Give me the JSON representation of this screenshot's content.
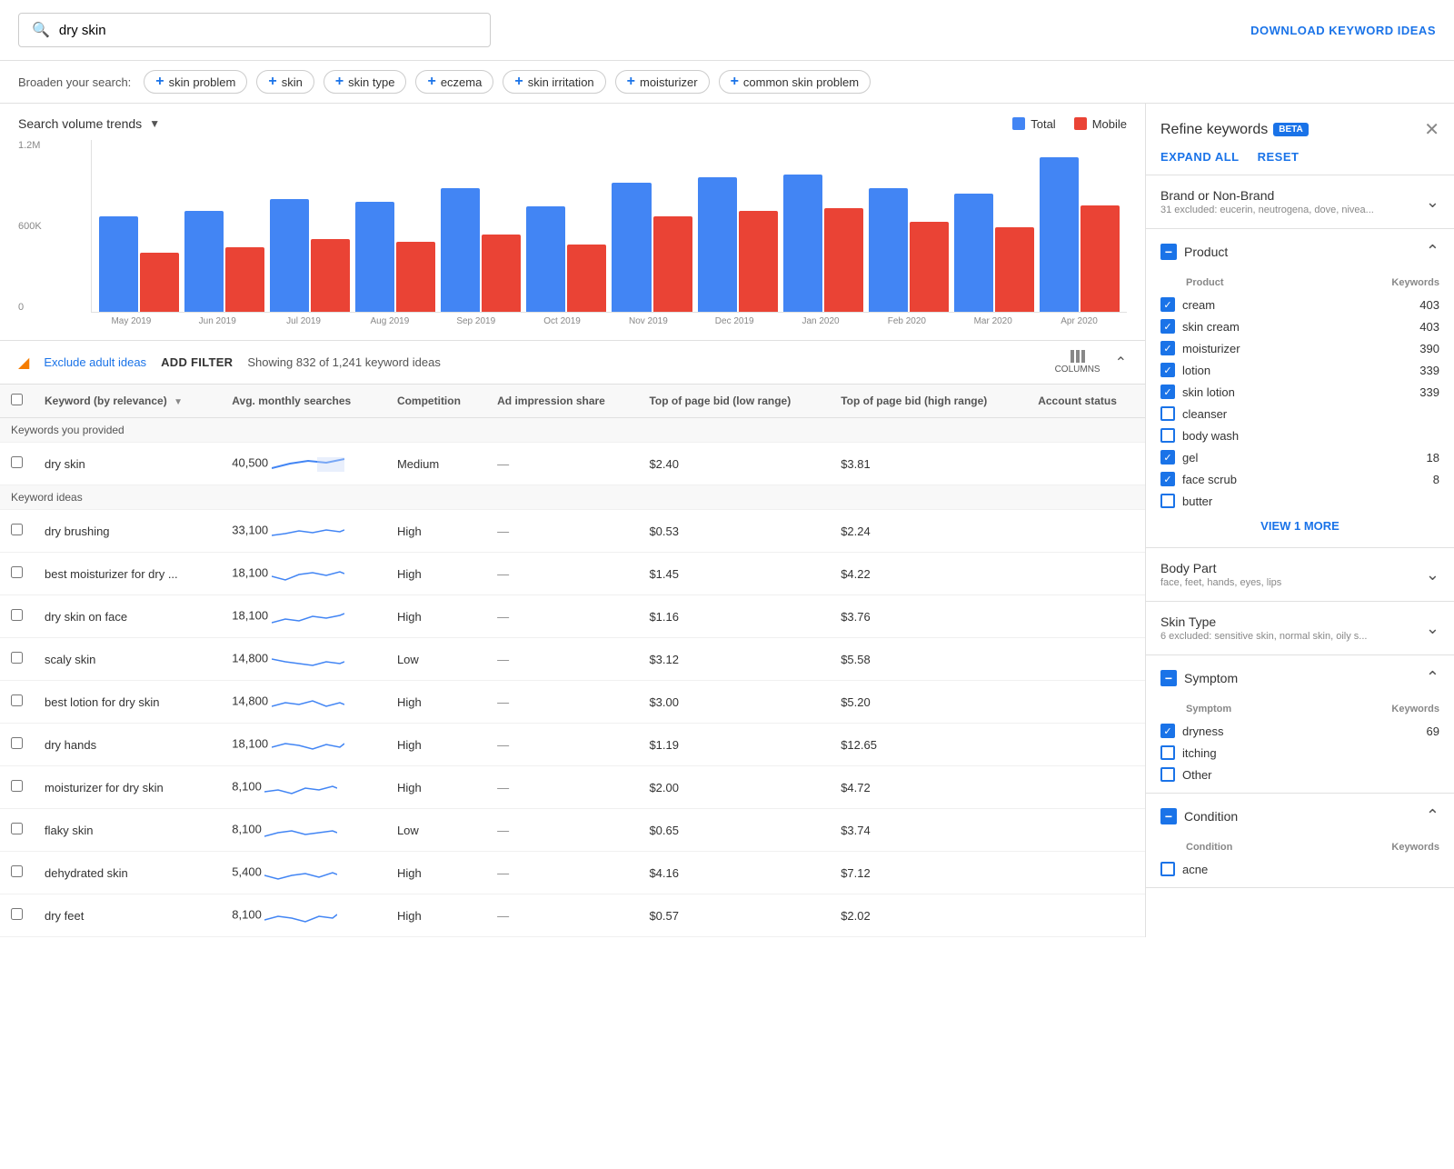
{
  "topbar": {
    "search_placeholder": "dry skin",
    "search_value": "dry skin",
    "download_label": "DOWNLOAD KEYWORD IDEAS"
  },
  "broaden": {
    "label": "Broaden your search:",
    "chips": [
      {
        "id": "skin-problem",
        "label": "skin problem"
      },
      {
        "id": "skin",
        "label": "skin"
      },
      {
        "id": "skin-type",
        "label": "skin type"
      },
      {
        "id": "eczema",
        "label": "eczema"
      },
      {
        "id": "skin-irritation",
        "label": "skin irritation"
      },
      {
        "id": "moisturizer",
        "label": "moisturizer"
      },
      {
        "id": "common-skin-problem",
        "label": "common skin problem"
      }
    ]
  },
  "chart": {
    "title": "Search volume trends",
    "y_labels": [
      "1.2M",
      "600K",
      "0"
    ],
    "legend": {
      "total_label": "Total",
      "mobile_label": "Mobile"
    },
    "x_labels": [
      "May 2019",
      "Jun 2019",
      "Jul 2019",
      "Aug 2019",
      "Sep 2019",
      "Oct 2019",
      "Nov 2019",
      "Dec 2019",
      "Jan 2020",
      "Feb 2020",
      "Mar 2020",
      "Apr 2020"
    ],
    "bars": [
      {
        "month": "May 2019",
        "total": 68,
        "mobile": 42
      },
      {
        "month": "Jun 2019",
        "total": 72,
        "mobile": 46
      },
      {
        "month": "Jul 2019",
        "total": 80,
        "mobile": 52
      },
      {
        "month": "Aug 2019",
        "total": 78,
        "mobile": 50
      },
      {
        "month": "Sep 2019",
        "total": 88,
        "mobile": 55
      },
      {
        "month": "Oct 2019",
        "total": 75,
        "mobile": 48
      },
      {
        "month": "Nov 2019",
        "total": 92,
        "mobile": 68
      },
      {
        "month": "Dec 2019",
        "total": 96,
        "mobile": 72
      },
      {
        "month": "Jan 2020",
        "total": 98,
        "mobile": 74
      },
      {
        "month": "Feb 2020",
        "total": 88,
        "mobile": 64
      },
      {
        "month": "Mar 2020",
        "total": 84,
        "mobile": 60
      },
      {
        "month": "Apr 2020",
        "total": 110,
        "mobile": 76
      }
    ]
  },
  "toolbar": {
    "exclude_label": "Exclude adult ideas",
    "add_filter_label": "ADD FILTER",
    "showing_text": "Showing 832 of 1,241 keyword ideas",
    "columns_label": "COLUMNS"
  },
  "table": {
    "headers": {
      "keyword": "Keyword (by relevance)",
      "avg_monthly": "Avg. monthly searches",
      "competition": "Competition",
      "ad_impression": "Ad impression share",
      "top_page_low": "Top of page bid (low range)",
      "top_page_high": "Top of page bid (high range)",
      "account_status": "Account status"
    },
    "provided_label": "Keywords you provided",
    "ideas_label": "Keyword ideas",
    "provided_rows": [
      {
        "keyword": "dry skin",
        "avg": "40,500",
        "competition": "Medium",
        "ad_impression": "—",
        "bid_low": "$2.40",
        "bid_high": "$3.81"
      }
    ],
    "idea_rows": [
      {
        "keyword": "dry brushing",
        "avg": "33,100",
        "competition": "High",
        "ad_impression": "—",
        "bid_low": "$0.53",
        "bid_high": "$2.24"
      },
      {
        "keyword": "best moisturizer for dry ...",
        "avg": "18,100",
        "competition": "High",
        "ad_impression": "—",
        "bid_low": "$1.45",
        "bid_high": "$4.22"
      },
      {
        "keyword": "dry skin on face",
        "avg": "18,100",
        "competition": "High",
        "ad_impression": "—",
        "bid_low": "$1.16",
        "bid_high": "$3.76"
      },
      {
        "keyword": "scaly skin",
        "avg": "14,800",
        "competition": "Low",
        "ad_impression": "—",
        "bid_low": "$3.12",
        "bid_high": "$5.58"
      },
      {
        "keyword": "best lotion for dry skin",
        "avg": "14,800",
        "competition": "High",
        "ad_impression": "—",
        "bid_low": "$3.00",
        "bid_high": "$5.20"
      },
      {
        "keyword": "dry hands",
        "avg": "18,100",
        "competition": "High",
        "ad_impression": "—",
        "bid_low": "$1.19",
        "bid_high": "$12.65"
      },
      {
        "keyword": "moisturizer for dry skin",
        "avg": "8,100",
        "competition": "High",
        "ad_impression": "—",
        "bid_low": "$2.00",
        "bid_high": "$4.72"
      },
      {
        "keyword": "flaky skin",
        "avg": "8,100",
        "competition": "Low",
        "ad_impression": "—",
        "bid_low": "$0.65",
        "bid_high": "$3.74"
      },
      {
        "keyword": "dehydrated skin",
        "avg": "5,400",
        "competition": "High",
        "ad_impression": "—",
        "bid_low": "$4.16",
        "bid_high": "$7.12"
      },
      {
        "keyword": "dry feet",
        "avg": "8,100",
        "competition": "High",
        "ad_impression": "—",
        "bid_low": "$0.57",
        "bid_high": "$2.02"
      }
    ]
  },
  "refine": {
    "title": "Refine keywords",
    "beta_label": "BETA",
    "expand_all_label": "EXPAND ALL",
    "reset_label": "RESET",
    "sections": [
      {
        "id": "brand",
        "title": "Brand or Non-Brand",
        "subtitle": "31 excluded: eucerin, neutrogena, dove, nivea...",
        "expanded": false,
        "has_indicator": false
      },
      {
        "id": "product",
        "title": "Product",
        "subtitle": "",
        "expanded": true,
        "has_indicator": true,
        "table_headers": {
          "col1": "Product",
          "col2": "Keywords"
        },
        "items": [
          {
            "label": "cream",
            "count": "403",
            "checked": true
          },
          {
            "label": "skin cream",
            "count": "403",
            "checked": true
          },
          {
            "label": "moisturizer",
            "count": "390",
            "checked": true
          },
          {
            "label": "lotion",
            "count": "339",
            "checked": true
          },
          {
            "label": "skin lotion",
            "count": "339",
            "checked": true
          },
          {
            "label": "cleanser",
            "count": "",
            "checked": false
          },
          {
            "label": "body wash",
            "count": "",
            "checked": false
          },
          {
            "label": "gel",
            "count": "18",
            "checked": true
          },
          {
            "label": "face scrub",
            "count": "8",
            "checked": true
          },
          {
            "label": "butter",
            "count": "",
            "checked": false
          }
        ],
        "view_more_label": "VIEW 1 MORE"
      },
      {
        "id": "body-part",
        "title": "Body Part",
        "subtitle": "face, feet, hands, eyes, lips",
        "expanded": false,
        "has_indicator": false
      },
      {
        "id": "skin-type",
        "title": "Skin Type",
        "subtitle": "6 excluded: sensitive skin, normal skin, oily s...",
        "expanded": false,
        "has_indicator": false
      },
      {
        "id": "symptom",
        "title": "Symptom",
        "subtitle": "",
        "expanded": true,
        "has_indicator": true,
        "table_headers": {
          "col1": "Symptom",
          "col2": "Keywords"
        },
        "items": [
          {
            "label": "dryness",
            "count": "69",
            "checked": true
          },
          {
            "label": "itching",
            "count": "",
            "checked": false
          },
          {
            "label": "Other",
            "count": "",
            "checked": false
          }
        ]
      },
      {
        "id": "condition",
        "title": "Condition",
        "subtitle": "",
        "expanded": true,
        "has_indicator": true,
        "table_headers": {
          "col1": "Condition",
          "col2": "Keywords"
        },
        "items": [
          {
            "label": "acne",
            "count": "",
            "checked": false
          }
        ]
      }
    ]
  },
  "colors": {
    "blue": "#4285f4",
    "red": "#ea4335",
    "brand": "#1a73e8"
  }
}
